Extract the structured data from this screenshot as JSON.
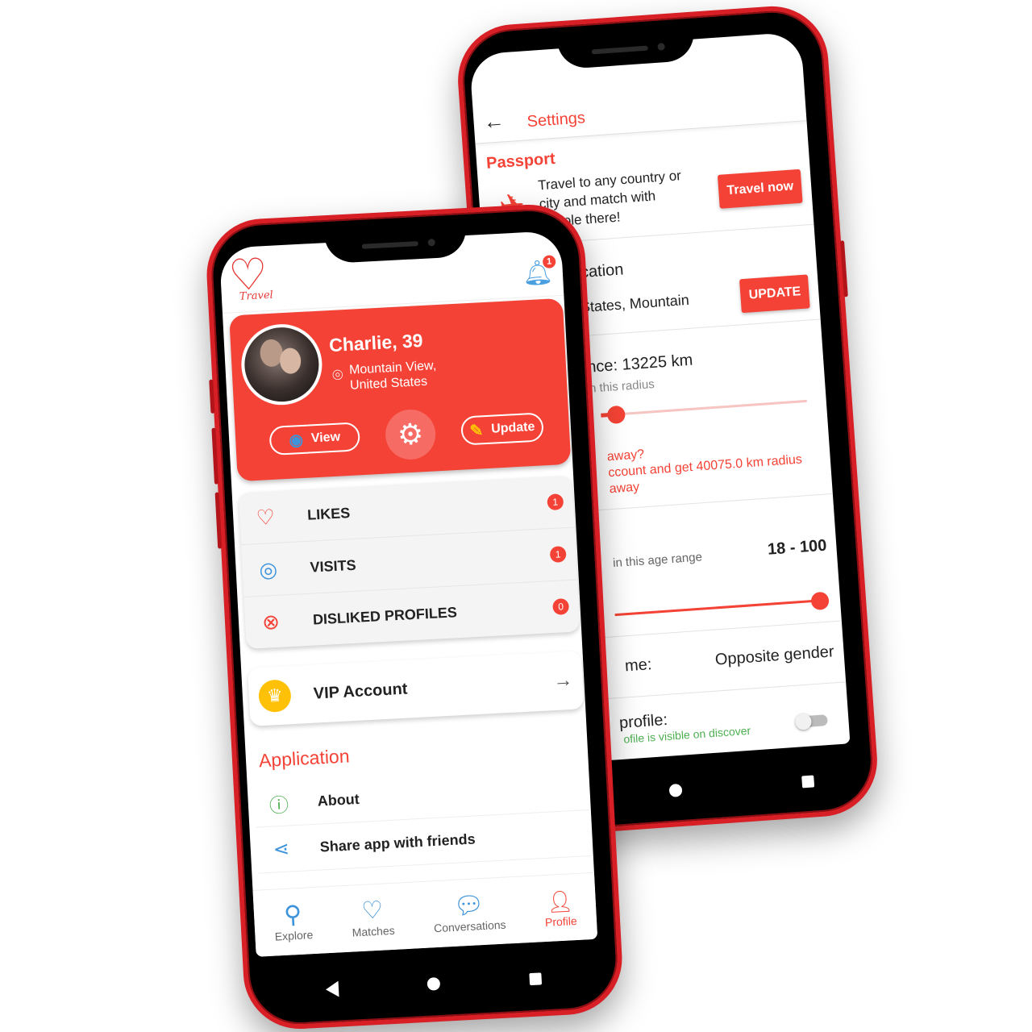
{
  "settings_screen": {
    "title": "Settings",
    "back_icon": "arrow-left-icon",
    "passport": {
      "title": "Passport",
      "icon": "airplane-icon",
      "text": "Travel to any country or city and match with people there!",
      "button": "Travel now"
    },
    "location": {
      "title": "ocation",
      "value": "States, Mountain",
      "button": "UPDATE"
    },
    "distance": {
      "title": "ance: 13225 km",
      "subtitle": "n this radius",
      "slider_value_km": 13225,
      "note_line1": "away?",
      "note_line2": "ccount and get 40075.0 km radius away"
    },
    "age": {
      "subtitle": "in this age range",
      "value": "18 - 100",
      "min": 18,
      "max": 100
    },
    "show_me": {
      "label": "me:",
      "value": "Opposite gender"
    },
    "profile_visibility": {
      "label": "profile:",
      "subtitle": "ofile is visible on discover",
      "enabled": false
    }
  },
  "profile_screen": {
    "logo_text": "Travel",
    "notification_count": "1",
    "user": {
      "name": "Charlie, 39",
      "location": "Mountain View, United States"
    },
    "buttons": {
      "view": "View",
      "update": "Update",
      "settings_icon": "gear-icon"
    },
    "menu": [
      {
        "label": "LIKES",
        "badge": "1",
        "icon": "heart-outline-icon",
        "icon_color": "#f44336"
      },
      {
        "label": "VISITS",
        "badge": "1",
        "icon": "eye-icon",
        "icon_color": "#3d94db"
      },
      {
        "label": "DISLIKED PROFILES",
        "badge": "0",
        "icon": "close-circle-icon",
        "icon_color": "#f44336"
      }
    ],
    "vip": {
      "label": "VIP Account",
      "icon": "crown-icon"
    },
    "application": {
      "title": "Application",
      "items": [
        {
          "label": "About",
          "icon": "info-icon",
          "icon_color": "#4caf50"
        },
        {
          "label": "Share app with friends",
          "icon": "share-icon",
          "icon_color": "#3d94db"
        }
      ]
    },
    "bottom_nav": [
      {
        "label": "Explore",
        "icon": "search-icon"
      },
      {
        "label": "Matches",
        "icon": "heart-icon"
      },
      {
        "label": "Conversations",
        "icon": "chat-icon"
      },
      {
        "label": "Profile",
        "icon": "person-icon",
        "active": true
      }
    ]
  },
  "colors": {
    "primary": "#f44336",
    "phone_frame": "#d71f25",
    "accent_blue": "#3d94db",
    "vip_gold": "#ffc107"
  }
}
